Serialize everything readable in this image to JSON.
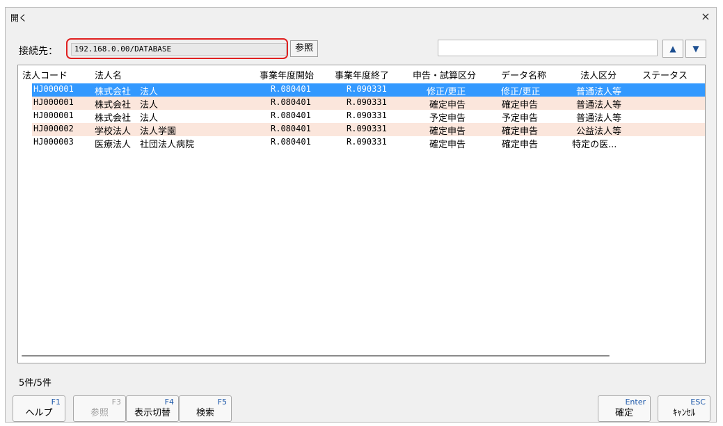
{
  "window": {
    "title": "開く",
    "close_glyph": "×"
  },
  "connection": {
    "label": "接続先：",
    "value": "192.168.0.00/DATABASE",
    "ref_button": "参照"
  },
  "search": {
    "value": "",
    "up_glyph": "▲",
    "down_glyph": "▼"
  },
  "grid": {
    "columns": [
      "法人コード",
      "法人名",
      "事業年度開始",
      "事業年度終了",
      "申告・試算区分",
      "データ名称",
      "法人区分",
      "ステータス"
    ],
    "rows": [
      {
        "code": "HJ000001",
        "name": "株式会社　法人",
        "start": "R.080401",
        "end": "R.090331",
        "type": "修正/更正",
        "data_name": "修正/更正",
        "category": "普通法人等",
        "status": ""
      },
      {
        "code": "HJ000001",
        "name": "株式会社　法人",
        "start": "R.080401",
        "end": "R.090331",
        "type": "確定申告",
        "data_name": "確定申告",
        "category": "普通法人等",
        "status": ""
      },
      {
        "code": "HJ000001",
        "name": "株式会社　法人",
        "start": "R.080401",
        "end": "R.090331",
        "type": "予定申告",
        "data_name": "予定申告",
        "category": "普通法人等",
        "status": ""
      },
      {
        "code": "HJ000002",
        "name": "学校法人　法人学園",
        "start": "R.080401",
        "end": "R.090331",
        "type": "確定申告",
        "data_name": "確定申告",
        "category": "公益法人等",
        "status": ""
      },
      {
        "code": "HJ000003",
        "name": "医療法人　社団法人病院",
        "start": "R.080401",
        "end": "R.090331",
        "type": "確定申告",
        "data_name": "確定申告",
        "category": "特定の医...",
        "status": ""
      }
    ],
    "selected_index": 0
  },
  "record_count": "5件/5件",
  "function_keys": [
    {
      "key": "F1",
      "label": "ヘルプ",
      "enabled": true
    },
    {
      "key": "F3",
      "label": "参照",
      "enabled": false
    },
    {
      "key": "F4",
      "label": "表示切替",
      "enabled": true
    },
    {
      "key": "F5",
      "label": "検索",
      "enabled": true
    },
    {
      "key": "Enter",
      "label": "確定",
      "enabled": true
    },
    {
      "key": "ESC",
      "label": "ｷｬﾝｾﾙ",
      "enabled": true
    }
  ],
  "colors": {
    "selected_row": "#3399ff",
    "alt_row": "#fbe6dc",
    "highlight_border": "#e02020"
  }
}
